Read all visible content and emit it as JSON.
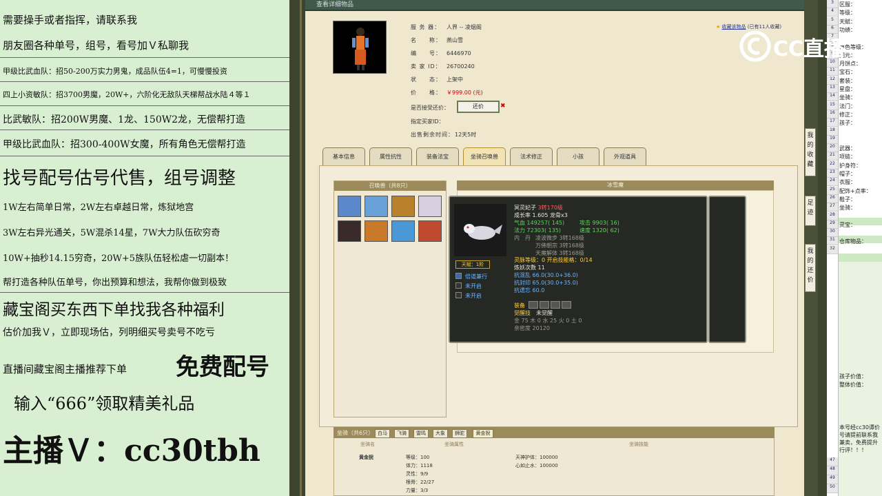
{
  "left_ads": [
    "需要操手或者指挥，请联系我",
    "朋友圈各种单号，组号，看号加Ｖ私聊我",
    "甲级比武血队：招50-200万实力男鬼，成品队伍4=1，可慢慢投资",
    "四上小资敏队：招3700男魔，20W+，六阶化无敌队天梯帮战水陆４等１",
    "比武敏队：招200W男魔、1龙、150W2龙，无偿帮打造",
    "甲级比武血队：招300-400W女魔，所有角色无偿帮打造",
    "找号配号估号代售，组号调整",
    "1W左右简单日常，2W左右卓越日常，炼狱地宫",
    "3W左右异光通关，5W混杀14星，7W大力队伍砍穷奇",
    "10W+抽秒14.15穷奇，20W+5族队伍轻松虐一切副本！",
    "帮打造各种队伍单号，你出预算和想法，我帮你做到极致",
    "藏宝阁买东西下单找我各种福利",
    "估价加我Ｖ，立即现场估，列明细买号卖号不吃亏",
    "直播间藏宝阁主播推荐下单",
    "免费配号",
    "输入“666”领取精美礼品",
    "主播Ｖ：cc30tbh"
  ],
  "window": {
    "title": "查看详细物品",
    "info": [
      {
        "k": "服 务 器：",
        "v": "人界 -- 凌烟阁"
      },
      {
        "k": "名　　称：",
        "v": "燕山雪"
      },
      {
        "k": "编　　号：",
        "v": "6446970"
      },
      {
        "k": "卖 家 ID：",
        "v": "26700240"
      },
      {
        "k": "状　　态：",
        "v": "上架中"
      },
      {
        "k": "价　　格：",
        "v": "￥999.00 (元)"
      },
      {
        "k": "是否接受还价：",
        "v": ""
      },
      {
        "k": "指定买家ID：",
        "v": ""
      },
      {
        "k": "出售剩余时间：",
        "v": "12天5时"
      }
    ],
    "bargain_label": "还价",
    "fav_link": "收藏该物品",
    "fav_count": "(已有11人收藏)",
    "tabs": [
      "基本信息",
      "属性抗性",
      "装备法宝",
      "坐骑召唤兽",
      "法术修正",
      "小孩",
      "外观道具"
    ],
    "active_tab": 3,
    "pets_title": "召唤兽（共8只）",
    "summon_title": "冰雪魔",
    "mount_title": "坐骑（共6只）",
    "mount_tabs": [
      "白马",
      "飞骑",
      "雷鸣",
      "大象",
      "狮驼",
      "黄金猊"
    ],
    "mount_sub": [
      "坐骑名",
      "坐骑属性",
      "坐骑技能"
    ],
    "mount_name": "黄金猊",
    "mount_stats": [
      "等级：100",
      "体力：1118",
      "灵性：9/9",
      "根骨：22/27",
      "力量：3/3"
    ],
    "mount_skills": [
      "天神护体：100000",
      "心如止水：100000"
    ]
  },
  "tooltip": {
    "name": "冥灵妃子",
    "rank": "3转170级",
    "growth": "成长率 1.605 龙骨x3",
    "hp": "气血 149257( 145)",
    "atk": "攻击 9903( 16)",
    "mp": "法力 72303( 135)",
    "spd": "速度 1320( 62)",
    "inner_lbl": "内　丹",
    "inner": [
      "凌波微步 3转168级",
      "万佛朝宗 3转168级",
      "天魔解体 3转168级"
    ],
    "spirit": "灵脉等级：0 开启技能格：0/14",
    "refine": "炼妖次数 11",
    "res1": "抗混乱 66.0(30.0+36.0)",
    "res2": "抗封印 65.0(30.0+35.0)",
    "res3": "抗遗忘 60.0",
    "equip_lbl": "装备",
    "awake_lbl": "觉醒技",
    "awake_val": "未觉醒",
    "elements": "金 75 木 0 水 25 火 0 土 0",
    "owner": "亲密度 20120",
    "tag": "天赋：1阶",
    "skills": [
      "倍道兼行",
      "未开启",
      "未开启"
    ]
  },
  "side_tabs": [
    "我的收藏",
    "足迹",
    "我的还价"
  ],
  "sheet": {
    "labels": [
      "区服：",
      "等级：",
      "天赋：",
      "功绩：",
      "",
      "角色等级：",
      "回元：",
      "月饼点：",
      "宝石：",
      "套装：",
      "星盘：",
      "坐骑：",
      "法门：",
      "修正：",
      "孩子：",
      "",
      "",
      "武器：",
      "项链：",
      "护身符：",
      "帽子：",
      "衣服：",
      "配饰+点率：",
      "鞋子：",
      "坐骑：",
      "",
      "灵宝：",
      "",
      "仓库物品："
    ],
    "bottom_labels": [
      "孩子价值：",
      "整体价值："
    ],
    "note": "本号经cc30谭价号请提前联系我兼卖，免费提升行评！！！",
    "row_nums": [
      "3",
      "4",
      "5",
      "6",
      "7",
      "8",
      "9",
      "10",
      "11",
      "12",
      "13",
      "14",
      "15",
      "16",
      "17",
      "18",
      "19",
      "20",
      "21",
      "22",
      "23",
      "24",
      "25",
      "26",
      "27",
      "28",
      "29",
      "30",
      "31",
      "32"
    ],
    "bottom_nums": [
      "47",
      "48",
      "49",
      "50"
    ]
  },
  "logo_text": "CC直播"
}
